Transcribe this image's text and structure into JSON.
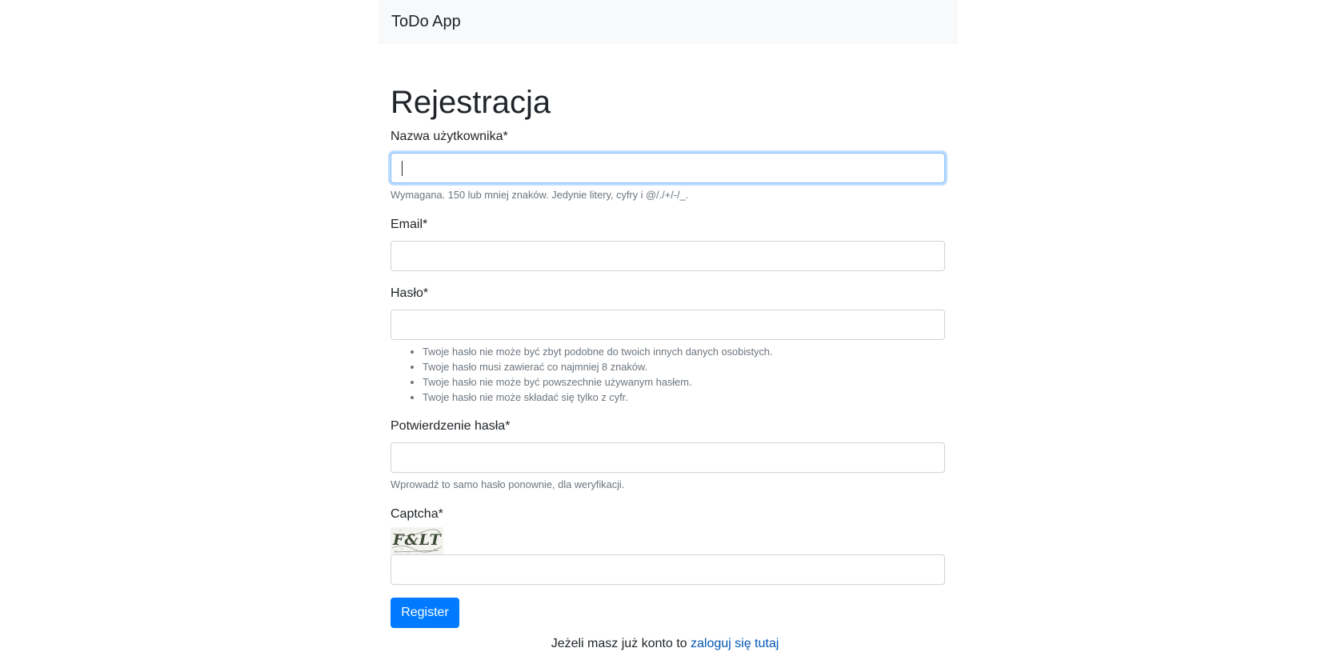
{
  "navbar": {
    "brand": "ToDo App"
  },
  "page": {
    "title": "Rejestracja"
  },
  "form": {
    "username": {
      "label": "Nazwa użytkownika*",
      "value": "",
      "help": "Wymagana. 150 lub mniej znaków. Jedynie litery, cyfry i @/./+/-/_."
    },
    "email": {
      "label": "Email*",
      "value": ""
    },
    "password": {
      "label": "Hasło*",
      "value": "",
      "rules": [
        "Twoje hasło nie może być zbyt podobne do twoich innych danych osobistych.",
        "Twoje hasło musi zawierać co najmniej 8 znaków.",
        "Twoje hasło nie może być powszechnie używanym hasłem.",
        "Twoje hasło nie może składać się tylko z cyfr."
      ]
    },
    "password_confirm": {
      "label": "Potwierdzenie hasła*",
      "value": "",
      "help": "Wprowadź to samo hasło ponownie, dla weryfikacji."
    },
    "captcha": {
      "label": "Captcha*",
      "image_text": "F&LT",
      "value": ""
    },
    "submit_label": "Register"
  },
  "login_prompt": {
    "text": "Jeżeli masz już konto to ",
    "link": "zaloguj się tutaj"
  },
  "colors": {
    "primary": "#007bff",
    "link": "#0056b3",
    "navbar_bg": "#f8f9fa",
    "muted": "#6c757d"
  }
}
